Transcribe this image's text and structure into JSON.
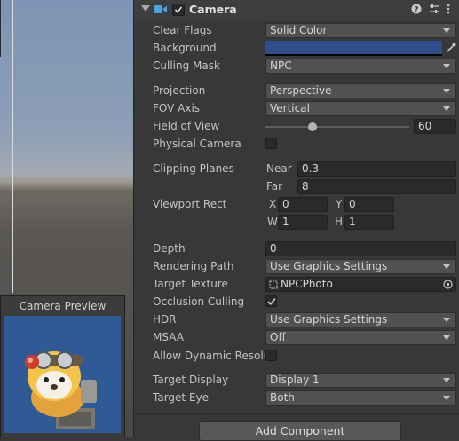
{
  "preview": {
    "title": "Camera Preview"
  },
  "component": {
    "title": "Camera",
    "checked": true
  },
  "fields": {
    "clear_flags": {
      "label": "Clear Flags",
      "value": "Solid Color"
    },
    "background": {
      "label": "Background",
      "color": "#2e4f8b"
    },
    "culling_mask": {
      "label": "Culling Mask",
      "value": "NPC"
    },
    "projection": {
      "label": "Projection",
      "value": "Perspective"
    },
    "fov_axis": {
      "label": "FOV Axis",
      "value": "Vertical"
    },
    "field_of_view": {
      "label": "Field of View",
      "value": "60",
      "slider_fraction": 0.33
    },
    "physical_camera": {
      "label": "Physical Camera",
      "checked": false
    },
    "clipping_planes": {
      "label": "Clipping Planes",
      "near_label": "Near",
      "near": "0.3",
      "far_label": "Far",
      "far": "8"
    },
    "viewport_rect": {
      "label": "Viewport Rect",
      "x_label": "X",
      "x": "0",
      "y_label": "Y",
      "y": "0",
      "w_label": "W",
      "w": "1",
      "h_label": "H",
      "h": "1"
    },
    "depth": {
      "label": "Depth",
      "value": "0"
    },
    "rendering_path": {
      "label": "Rendering Path",
      "value": "Use Graphics Settings"
    },
    "target_texture": {
      "label": "Target Texture",
      "value": "NPCPhoto"
    },
    "occlusion_culling": {
      "label": "Occlusion Culling",
      "checked": true
    },
    "hdr": {
      "label": "HDR",
      "value": "Use Graphics Settings"
    },
    "msaa": {
      "label": "MSAA",
      "value": "Off"
    },
    "allow_dynamic": {
      "label": "Allow Dynamic Resolu",
      "checked": false
    },
    "target_display": {
      "label": "Target Display",
      "value": "Display 1"
    },
    "target_eye": {
      "label": "Target Eye",
      "value": "Both"
    }
  },
  "footer": {
    "add_component_label": "Add Component"
  }
}
